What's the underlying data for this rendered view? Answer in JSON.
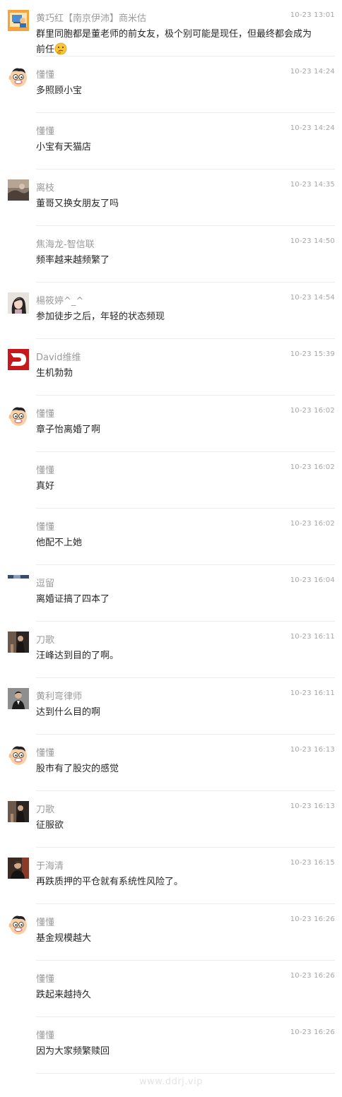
{
  "messages": [
    {
      "name": "黄巧红【南京伊沛】商米估",
      "time": "10-23 13:01",
      "text": "群里同胞都是董老师的前女友，极个别可能是现任，但最终都会成为前任",
      "avatar_icon": "computer-user-avatar-icon",
      "emoji_icon": "thinking-face-emoji-icon"
    },
    {
      "name": "懂懂",
      "time": "10-23 14:24",
      "text": "多照顾小宝",
      "avatar_icon": "cartoon-face-avatar-icon"
    },
    {
      "name": "懂懂",
      "time": "10-23 14:24",
      "text": "小宝有天猫店",
      "avatar_icon": ""
    },
    {
      "name": "离枝",
      "time": "10-23 14:35",
      "text": "董哥又换女朋友了吗",
      "avatar_icon": "photo-avatar-icon"
    },
    {
      "name": "焦海龙-智信联",
      "time": "10-23 14:50",
      "text": "频率越来越频繁了",
      "avatar_icon": ""
    },
    {
      "name": "楊筱婷^_^",
      "time": "10-23 14:54",
      "text": "参加徒步之后，年轻的状态频现",
      "avatar_icon": "woman-photo-avatar-icon"
    },
    {
      "name": "David维维",
      "time": "10-23 15:39",
      "text": "生机勃勃",
      "avatar_icon": "red-d-logo-avatar-icon"
    },
    {
      "name": "懂懂",
      "time": "10-23 16:02",
      "text": "章子怡离婚了啊",
      "avatar_icon": "cartoon-face-avatar-icon"
    },
    {
      "name": "懂懂",
      "time": "10-23 16:02",
      "text": "真好",
      "avatar_icon": ""
    },
    {
      "name": "懂懂",
      "time": "10-23 16:02",
      "text": "他配不上她",
      "avatar_icon": ""
    },
    {
      "name": "逗留",
      "time": "10-23 16:04",
      "text": "离婚证搞了四本了",
      "avatar_icon": "partial-photo-avatar-icon"
    },
    {
      "name": "刀歌",
      "time": "10-23 16:11",
      "text": "汪峰达到目的了啊。",
      "avatar_icon": "dark-photo-avatar-icon"
    },
    {
      "name": "黄利弯律师",
      "time": "10-23 16:11",
      "text": "达到什么目的啊",
      "avatar_icon": "lawyer-photo-avatar-icon"
    },
    {
      "name": "懂懂",
      "time": "10-23 16:13",
      "text": "股市有了股灾的感觉",
      "avatar_icon": "cartoon-face-avatar-icon"
    },
    {
      "name": "刀歌",
      "time": "10-23 16:13",
      "text": "征服欲",
      "avatar_icon": "dark-photo-avatar-icon"
    },
    {
      "name": "于海清",
      "time": "10-23 16:15",
      "text": "再跌质押的平仓就有系统性风险了。",
      "avatar_icon": "man-photo-avatar-icon"
    },
    {
      "name": "懂懂",
      "time": "10-23 16:26",
      "text": "基金规模越大",
      "avatar_icon": "cartoon-face-avatar-icon"
    },
    {
      "name": "懂懂",
      "time": "10-23 16:26",
      "text": "跌起来越持久",
      "avatar_icon": ""
    },
    {
      "name": "懂懂",
      "time": "10-23 16:26",
      "text": "因为大家频繁赎回",
      "avatar_icon": ""
    }
  ],
  "watermark": "www.ddrj.vip",
  "colors": {
    "name": "#9b9b9b",
    "time": "#a6a6a6",
    "text": "#262626",
    "divider": "#ececec",
    "david_red": "#c8161d"
  }
}
